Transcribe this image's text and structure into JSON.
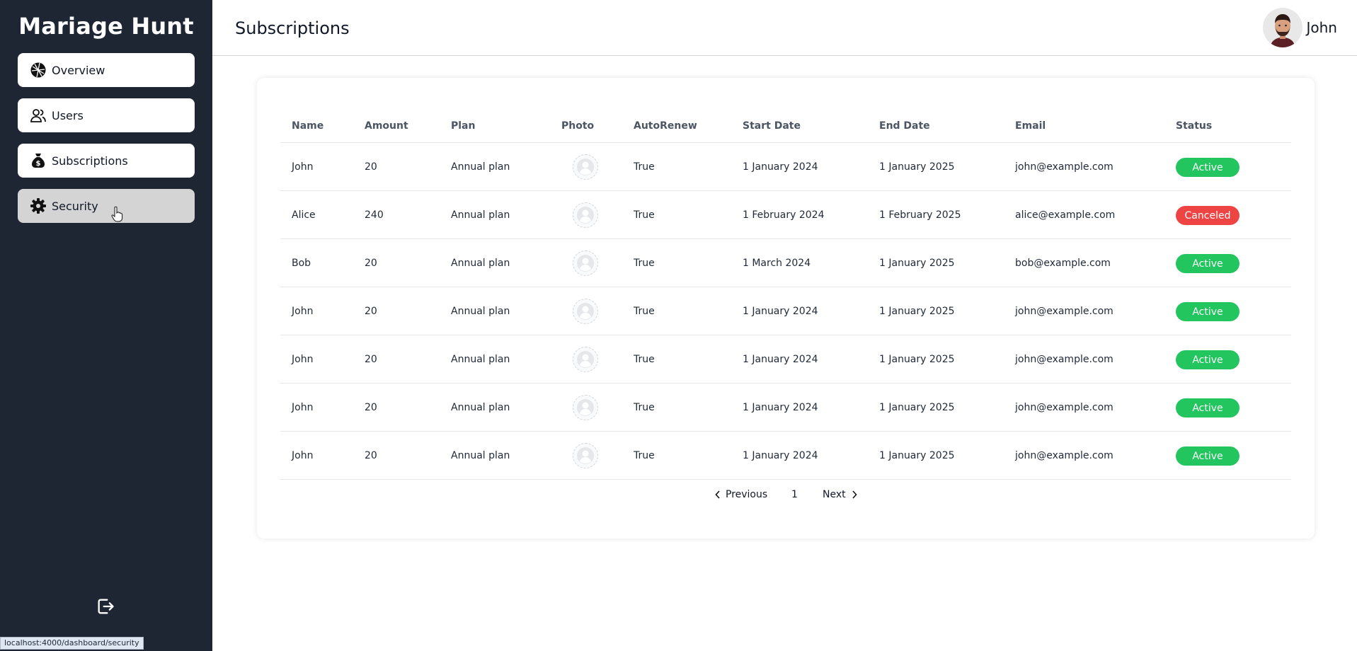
{
  "app": {
    "brand": "Mariage Hunt"
  },
  "sidebar": {
    "items": [
      {
        "label": "Overview",
        "icon": "dashboard-icon",
        "active": false
      },
      {
        "label": "Users",
        "icon": "users-icon",
        "active": false
      },
      {
        "label": "Subscriptions",
        "icon": "money-bag-icon",
        "active": false
      },
      {
        "label": "Security",
        "icon": "gear-icon",
        "active": true
      }
    ],
    "logout_icon": "logout-icon"
  },
  "header": {
    "title": "Subscriptions",
    "user_name": "John"
  },
  "table": {
    "columns": [
      "Name",
      "Amount",
      "Plan",
      "Photo",
      "AutoRenew",
      "Start Date",
      "End Date",
      "Email",
      "Status"
    ],
    "rows": [
      {
        "name": "John",
        "amount": "20",
        "plan": "Annual plan",
        "autorenew": "True",
        "start": "1 January 2024",
        "end": "1 January 2025",
        "email": "john@example.com",
        "status": "Active"
      },
      {
        "name": "Alice",
        "amount": "240",
        "plan": "Annual plan",
        "autorenew": "True",
        "start": "1 February 2024",
        "end": "1 February 2025",
        "email": "alice@example.com",
        "status": "Canceled"
      },
      {
        "name": "Bob",
        "amount": "20",
        "plan": "Annual plan",
        "autorenew": "True",
        "start": "1 March 2024",
        "end": "1 January 2025",
        "email": "bob@example.com",
        "status": "Active"
      },
      {
        "name": "John",
        "amount": "20",
        "plan": "Annual plan",
        "autorenew": "True",
        "start": "1 January 2024",
        "end": "1 January 2025",
        "email": "john@example.com",
        "status": "Active"
      },
      {
        "name": "John",
        "amount": "20",
        "plan": "Annual plan",
        "autorenew": "True",
        "start": "1 January 2024",
        "end": "1 January 2025",
        "email": "john@example.com",
        "status": "Active"
      },
      {
        "name": "John",
        "amount": "20",
        "plan": "Annual plan",
        "autorenew": "True",
        "start": "1 January 2024",
        "end": "1 January 2025",
        "email": "john@example.com",
        "status": "Active"
      },
      {
        "name": "John",
        "amount": "20",
        "plan": "Annual plan",
        "autorenew": "True",
        "start": "1 January 2024",
        "end": "1 January 2025",
        "email": "john@example.com",
        "status": "Active"
      }
    ]
  },
  "pagination": {
    "previous": "Previous",
    "page": "1",
    "next": "Next"
  },
  "status_bar": {
    "url": "localhost:4000/dashboard/security"
  },
  "colors": {
    "sidebar_bg": "#1e2633",
    "active_badge": "#22c55e",
    "canceled_badge": "#ef4444",
    "active_nav": "#d4d4d4"
  }
}
